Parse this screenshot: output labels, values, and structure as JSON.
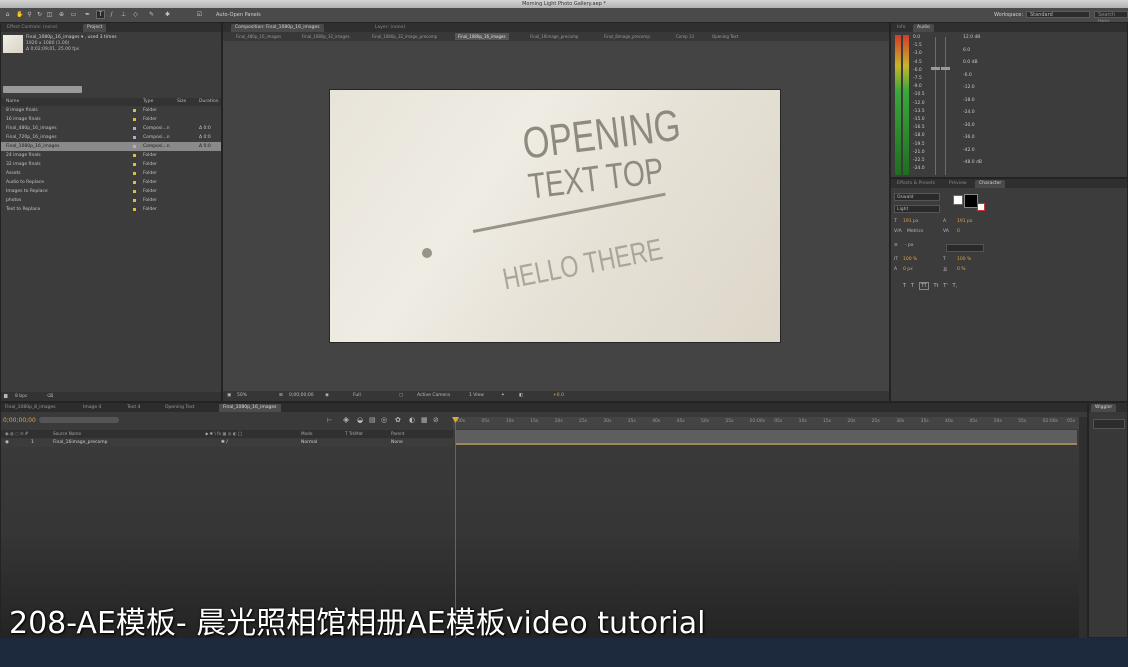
{
  "window": {
    "title": "Morning Light Photo Gallery.aep *"
  },
  "toolbar": {
    "auto_open_panels": "Auto-Open Panels",
    "workspace_label": "Workspace:",
    "workspace_value": "Standard",
    "search_placeholder": "Search Help"
  },
  "project_panel": {
    "tabs": [
      "Effect Controls: (none)",
      "Project"
    ],
    "selected_name": "Final_1080p_16_images ▾ , used 3 times",
    "selected_res": "1920 x 1080 (1.00)",
    "selected_dur": "Δ 0;02;09;01, 25.00 fps",
    "columns": [
      "Name",
      "Type",
      "Size",
      "Duration"
    ],
    "items": [
      {
        "name": "8 image finals",
        "type": "Folder",
        "duration": "",
        "color": "#d8c23a"
      },
      {
        "name": "16 image finals",
        "type": "Folder",
        "duration": "",
        "color": "#d8c23a"
      },
      {
        "name": "Final_480p_16_images",
        "type": "Composi...n",
        "duration": "Δ 0:0",
        "color": "#b8a6d8"
      },
      {
        "name": "Final_720p_16_images",
        "type": "Composi...n",
        "duration": "Δ 0:0",
        "color": "#b8a6d8"
      },
      {
        "name": "Final_1080p_16_images",
        "type": "Composi...n",
        "duration": "Δ 0:0",
        "color": "#b8a6d8",
        "selected": true
      },
      {
        "name": "24 image finals",
        "type": "Folder",
        "duration": "",
        "color": "#d8c23a"
      },
      {
        "name": "32 image finals",
        "type": "Folder",
        "duration": "",
        "color": "#d8c23a"
      },
      {
        "name": "Assets",
        "type": "Folder",
        "duration": "",
        "color": "#d8c23a"
      },
      {
        "name": "Audio to Replace",
        "type": "Folder",
        "duration": "",
        "color": "#d8c23a"
      },
      {
        "name": "Images to Replace",
        "type": "Folder",
        "duration": "",
        "color": "#d8c23a"
      },
      {
        "name": "photos",
        "type": "Folder",
        "duration": "",
        "color": "#d8c23a"
      },
      {
        "name": "Text to Replace",
        "type": "Folder",
        "duration": "",
        "color": "#d8c23a"
      }
    ],
    "bpc": "8 bpc"
  },
  "comp_panel": {
    "header_tabs": [
      "Composition: Final_1080p_16_images",
      "Layer: (none)"
    ],
    "breadcrumbs": [
      "Final_480p_16_images",
      "Final_1080p_32_images",
      "Final_1080p_32_image_precomp",
      "Final_1080p_16_images",
      "Final_16image_precomp",
      "Final_8image_precomp",
      "Comp 13",
      "Opening Text"
    ],
    "active_breadcrumb": 3,
    "canvas": {
      "line1": "OPENING",
      "line2": "TEXT TOP",
      "line3": "HELLO THERE"
    },
    "footer": {
      "zoom": "50%",
      "timecode": "0;00;00;00",
      "resolution": "Full",
      "camera": "Active Camera",
      "view": "1 View",
      "exposure": "+0.0"
    }
  },
  "info_audio": {
    "tabs": [
      "Info",
      "Audio"
    ],
    "left_scale": [
      "0.0",
      "-1.5",
      "-3.0",
      "-4.5",
      "-6.0",
      "-7.5",
      "-9.0",
      "-10.5",
      "-12.0",
      "-13.5",
      "-15.0",
      "-16.5",
      "-18.0",
      "-19.5",
      "-21.0",
      "-22.5",
      "-24.0"
    ],
    "right_scale": [
      "12.0 dB",
      "6.0",
      "0.0 dB",
      "-6.0",
      "-12.0",
      "-18.0",
      "-24.0",
      "-30.0",
      "-36.0",
      "-42.0",
      "-48.0 dB"
    ]
  },
  "character_panel": {
    "tabs": [
      "Effects & Presets",
      "Preview",
      "Character"
    ],
    "font_family": "Oswald",
    "font_style": "Light",
    "font_size": "191 px",
    "leading": "191 px",
    "kerning": "Metrics",
    "tracking": "0",
    "stroke_width": "- px",
    "vscale": "100 %",
    "hscale": "100 %",
    "baseline": "0 px",
    "tsume": "0 %"
  },
  "timeline": {
    "tabs": [
      "Final_1080p_8_images",
      "Image 4",
      "Text 4",
      "Opening Text",
      "Final_1080p_16_images"
    ],
    "active_tab": 4,
    "timecode": "0;00;00;00",
    "columns": [
      "Source Name",
      "Mode",
      "T TrkMat",
      "Parent"
    ],
    "layer": {
      "index": "1",
      "name": "Final_16image_precomp",
      "mode": "Normal",
      "parent": "None"
    },
    "ruler": [
      "00s",
      "05s",
      "10s",
      "15s",
      "20s",
      "25s",
      "30s",
      "35s",
      "40s",
      "45s",
      "50s",
      "55s",
      "01:00s",
      "05s",
      "10s",
      "15s",
      "20s",
      "25s",
      "30s",
      "35s",
      "40s",
      "45s",
      "50s",
      "55s",
      "02:00s",
      "05s"
    ]
  },
  "wiggler": {
    "title": "Wiggler"
  },
  "caption": "208-AE模板- 晨光照相馆相册AE模板video tutorial"
}
